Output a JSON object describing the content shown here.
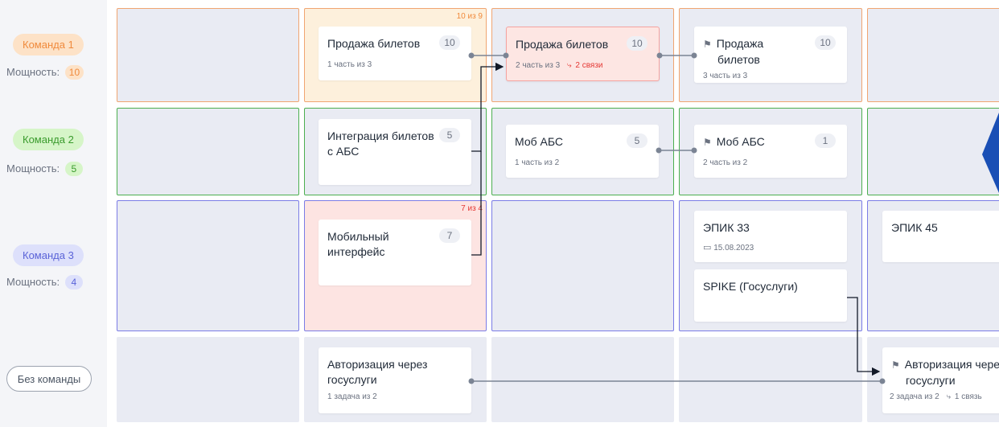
{
  "teams": [
    {
      "name": "Команда 1",
      "capacity_label": "Мощность:",
      "capacity": "10",
      "pill_bg": "#fde2c7",
      "pill_fg": "#f08a3c",
      "badge_bg": "#fde2c7",
      "badge_fg": "#f08a3c"
    },
    {
      "name": "Команда 2",
      "capacity_label": "Мощность:",
      "capacity": "5",
      "pill_bg": "#d6f5c8",
      "pill_fg": "#3a9b2d",
      "badge_bg": "#d6f5c8",
      "badge_fg": "#3a9b2d"
    },
    {
      "name": "Команда 3",
      "capacity_label": "Мощность:",
      "capacity": "4",
      "pill_bg": "#dde0fb",
      "pill_fg": "#5a63d8",
      "badge_bg": "#dde0fb",
      "badge_fg": "#5a63d8"
    }
  ],
  "no_team_label": "Без команды",
  "cell_warnings": {
    "team1_col2": "10 из 9",
    "team3_col2": "7 из 4"
  },
  "warning_colors": {
    "orange": "#f08a3c",
    "red": "#e53935"
  },
  "cards": {
    "sale1": {
      "title": "Продажа билетов",
      "count": "10",
      "sub": "1 часть из 3"
    },
    "sale2": {
      "title": "Продажа билетов",
      "count": "10",
      "sub": "2 часть из 3",
      "links": "2 связи"
    },
    "sale3": {
      "title_line1": "Продажа",
      "title_line2": "билетов",
      "count": "10",
      "sub": "3 часть из 3"
    },
    "integration": {
      "title_line1": "Интеграция билетов",
      "title_line2": "с АБС",
      "count": "5"
    },
    "mob1": {
      "title": "Моб АБС",
      "count": "5",
      "sub": "1 часть из 2"
    },
    "mob2": {
      "title": "Моб АБС",
      "count": "1",
      "sub": "2 часть из 2"
    },
    "mobile_ui": {
      "title_line1": "Мобильный",
      "title_line2": "интерфейс",
      "count": "7"
    },
    "epic33": {
      "title": "ЭПИК 33",
      "date": "15.08.2023"
    },
    "epic45": {
      "title": "ЭПИК 45"
    },
    "spike": {
      "title": "SPIKE (Госуслуги)"
    },
    "auth1": {
      "title_line1": "Авторизация через",
      "title_line2": "госуслуги",
      "sub": "1 задача из 2"
    },
    "auth2": {
      "title_line1": "Авторизация через",
      "title_line2": "госуслуги",
      "sub": "2 задача из 2",
      "links": "1 связь"
    }
  },
  "icons": {
    "flag": "flag-icon",
    "calendar": "calendar-icon",
    "link": "link-icon",
    "arrow": "arrow-decor-icon"
  },
  "accent_blue": "#1a4fb5"
}
